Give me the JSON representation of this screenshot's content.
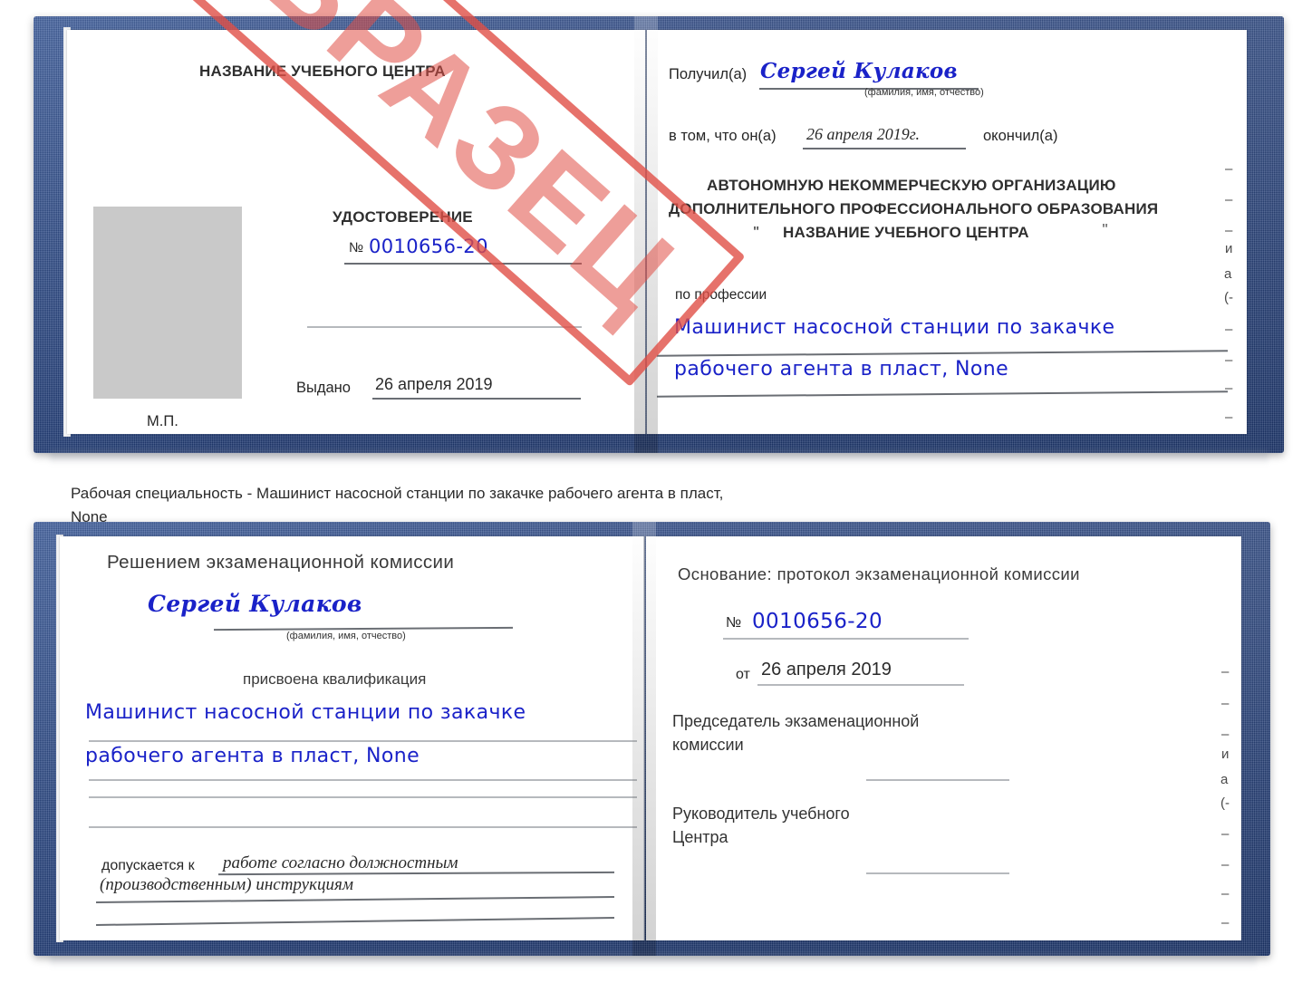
{
  "document": {
    "type": "Удостоверение",
    "number": "0010656-20",
    "issue_date": "26 апреля 2019",
    "holder_name": "Сергей Кулаков",
    "watermark": "ОБРАЗЕЦ"
  },
  "caption": {
    "line1": "Рабочая специальность - Машинист насосной станции по закачке рабочего агента в пласт,",
    "line2": "None"
  },
  "cert_top": {
    "left_page": {
      "center_name": "НАЗВАНИЕ УЧЕБНОГО ЦЕНТРА",
      "title": "УДОСТОВЕРЕНИЕ",
      "number_symbol": "№",
      "number_value": "0010656-20",
      "issued_label": "Выдано",
      "issued_value": "26 апреля 2019",
      "seal_label": "М.П."
    },
    "right_page": {
      "received_label": "Получил(а)",
      "received_value": "Сергей Кулаков",
      "fio_hint": "(фамилия, имя, отчество)",
      "in_that_label": "в том, что он(а)",
      "in_that_value": "26 апреля 2019г.",
      "finished_label": "окончил(а)",
      "org_line1": "АВТОНОМНУЮ НЕКОММЕРЧЕСКУЮ ОРГАНИЗАЦИЮ",
      "org_line2": "ДОПОЛНИТЕЛЬНОГО ПРОФЕССИОНАЛЬНОГО ОБРАЗОВАНИЯ",
      "org_quote_open": "\"",
      "org_line3": "НАЗВАНИЕ УЧЕБНОГО ЦЕНТРА",
      "org_quote_close": "\"",
      "profession_label": "по профессии",
      "profession_line1": "Машинист насосной станции по закачке",
      "profession_line2": "рабочего агента в пласт, None"
    },
    "edge_fragments": [
      "–",
      "–",
      "–",
      "и",
      "а",
      "(-",
      "–",
      "–",
      "–",
      "–"
    ]
  },
  "cert_bottom": {
    "left_page": {
      "heading": "Решением экзаменационной комиссии",
      "name_value": "Сергей Кулаков",
      "fio_hint": "(фамилия, имя, отчество)",
      "qualification_label": "присвоена квалификация",
      "qualification_line1": "Машинист насосной станции по закачке",
      "qualification_line2": "рабочего агента в пласт, None",
      "admitted_label": "допускается к",
      "admitted_line1": "работе согласно должностным",
      "admitted_line2": "(производственным) инструкциям"
    },
    "right_page": {
      "basis_label": "Основание: протокол экзаменационной комиссии",
      "number_symbol": "№",
      "number_value": "0010656-20",
      "from_label": "от",
      "from_value": "26 апреля 2019",
      "chairman_line1": "Председатель экзаменационной",
      "chairman_line2": "комиссии",
      "head_line1": "Руководитель учебного",
      "head_line2": "Центра"
    },
    "edge_fragments": [
      "–",
      "–",
      "–",
      "и",
      "а",
      "(-",
      "–",
      "–",
      "–",
      "–"
    ]
  },
  "colors": {
    "cover_blue": "#23407f",
    "stamp_red": "#e04f46",
    "handwriting_blue": "#1a22c8",
    "photo_grey": "#c9c9c9",
    "rule_grey": "#9fa3a8"
  }
}
